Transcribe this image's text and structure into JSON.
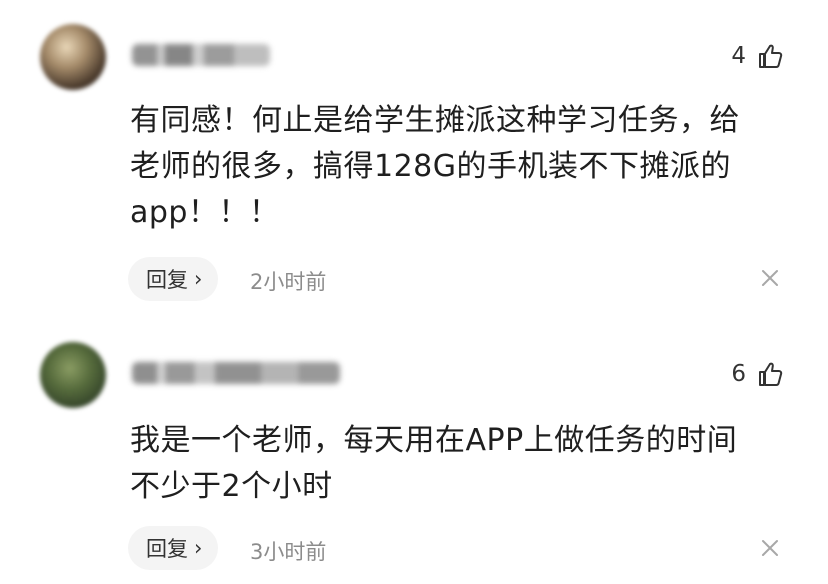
{
  "comments": [
    {
      "likes": "4",
      "text": "有同感！何止是给学生摊派这种学习任务，给\n老师的很多，搞得128G的手机装不下摊派的\napp！！！",
      "reply_label": "回复",
      "reply_chevron": "›",
      "time": "2小时前",
      "icons": {
        "like": "thumbs-up-icon",
        "close": "close-icon"
      }
    },
    {
      "likes": "6",
      "text": "我是一个老师，每天用在APP上做任务的时间\n不少于2个小时",
      "reply_label": "回复",
      "reply_chevron": "›",
      "time": "3小时前",
      "icons": {
        "like": "thumbs-up-icon",
        "close": "close-icon"
      }
    }
  ]
}
